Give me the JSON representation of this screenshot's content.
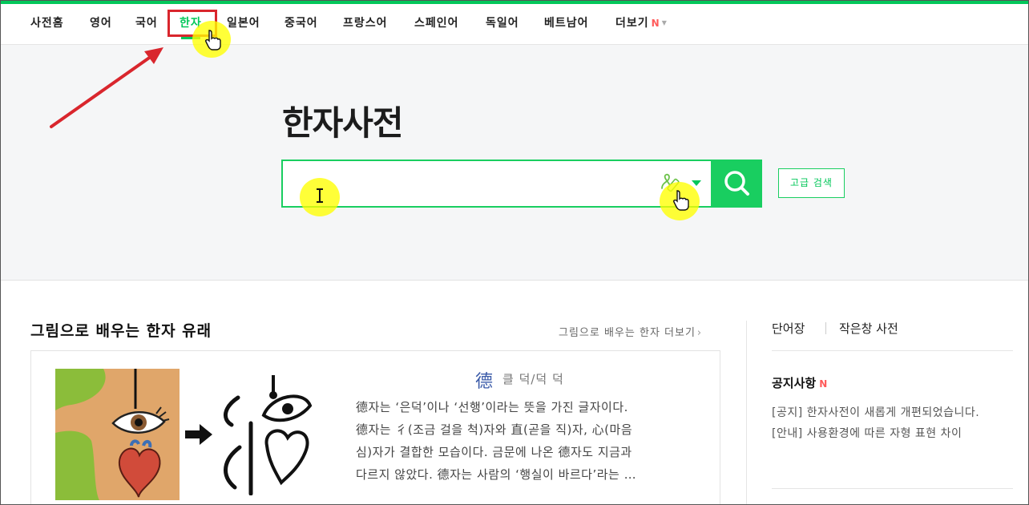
{
  "nav": {
    "items": [
      {
        "label": "사전홈"
      },
      {
        "label": "영어"
      },
      {
        "label": "국어"
      },
      {
        "label": "한자"
      },
      {
        "label": "일본어"
      },
      {
        "label": "중국어"
      },
      {
        "label": "프랑스어"
      },
      {
        "label": "스페인어"
      },
      {
        "label": "독일어"
      },
      {
        "label": "베트남어"
      },
      {
        "label": "더보기"
      }
    ],
    "active": "한자",
    "more_badge": "N"
  },
  "hero": {
    "title": "한자사전",
    "search_value": "",
    "advanced_search_label": "고급 검색"
  },
  "section": {
    "title": "그림으로 배우는 한자 유래",
    "more_link": "그림으로 배우는 한자 더보기"
  },
  "card": {
    "hanja": "德",
    "sound": "클 덕/덕 덕",
    "lines": [
      "德자는 ‘은덕’이나 ‘선행’이라는 뜻을 가진 글자이다.",
      "德자는 彳(조금 걸을 척)자와 直(곧을 직)자, 心(마음",
      "심)자가 결합한 모습이다. 금문에 나온 德자도 지금과",
      "다르지 않았다. 德자는 사람의 ‘행실이 바르다’라는 …"
    ]
  },
  "sidebar": {
    "tab_vocab": "단어장",
    "tab_small": "작은창 사전",
    "notice_title": "공지사항",
    "notice_badge": "N",
    "notices": [
      "[공지] 한자사전이 새롭게 개편되었습니다.",
      "[안내] 사용환경에 따른 자형 표현 차이"
    ]
  },
  "colors": {
    "brand": "#03c75a",
    "search_border": "#19ce60",
    "badge": "#ff5a5a",
    "annotation": "#d9262d",
    "highlight": "#ffff00"
  },
  "icons": {
    "search": "search-icon",
    "handwriting": "handwriting-icon",
    "cursor_hand": "hand-cursor-icon",
    "cursor_text": "text-cursor-icon"
  }
}
